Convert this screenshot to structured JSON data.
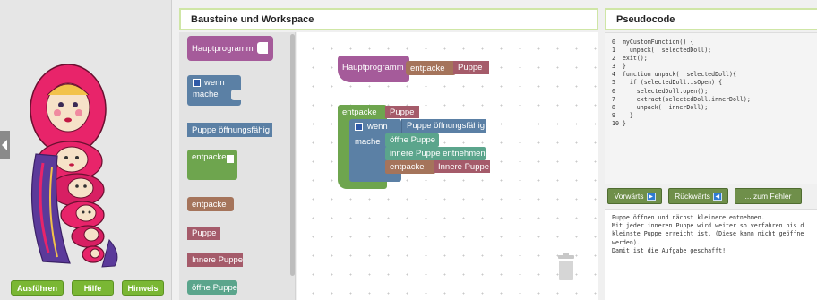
{
  "left_panel": {
    "collapse_icon": "chevron-left-icon",
    "image_alt": "matryoshka dolls",
    "buttons": {
      "run": "Ausführen",
      "help": "Hilfe",
      "hint": "Hinweis"
    }
  },
  "workspace_header": "Bausteine und Workspace",
  "pseudocode_header": "Pseudocode",
  "toolbox": {
    "main_program": "Hauptprogramm",
    "if_word": "wenn",
    "do_word": "mache",
    "doll_openable": "Puppe öffnungsfähig",
    "unpack": "entpacke",
    "unpack2": "entpacke",
    "doll": "Puppe",
    "inner_doll": "Innere Puppe",
    "open_doll": "öffne Puppe"
  },
  "workspace": {
    "main_program": "Hauptprogramm",
    "main_call": "entpacke",
    "main_arg": "Puppe",
    "fn_name": "entpacke",
    "fn_param": "Puppe",
    "if_word": "wenn",
    "cond": "Puppe öffnungsfähig",
    "do_word": "mache",
    "stmt1": "öffne Puppe",
    "stmt2": "innere Puppe entnehmen",
    "stmt3_call": "entpacke",
    "stmt3_arg": "Innere Puppe"
  },
  "pseudocode_lines": "0  myCustomFunction() {\n1    unpack(  selectedDoll);\n2  exit();\n3  }\n4  function unpack(  selectedDoll){\n5    if (selectedDoll.isOpen) {\n6      selectedDoll.open();\n7      extract(selectedDoll.innerDoll);\n8      unpack(  innerDoll);\n9    }\n10 }",
  "nav": {
    "forward": "Vorwärts",
    "backward": "Rückwärts",
    "to_error": "... zum Fehler"
  },
  "description": "Puppe öffnen und nächst kleinere entnehmen.\nMit jeder inneren Puppe wird weiter so verfahren bis d\nkleinste Puppe erreicht ist. (Diese kann nicht geöffne\nwerden).\nDamit ist die Aufgabe geschafft!",
  "colors": {
    "procedure": "#a55b9a",
    "logic": "#5b80a5",
    "action": "#5ba58c",
    "variable": "#a55b6a",
    "call": "#a5745b",
    "loop": "#6ea54e",
    "run_button": "#7ab734"
  }
}
